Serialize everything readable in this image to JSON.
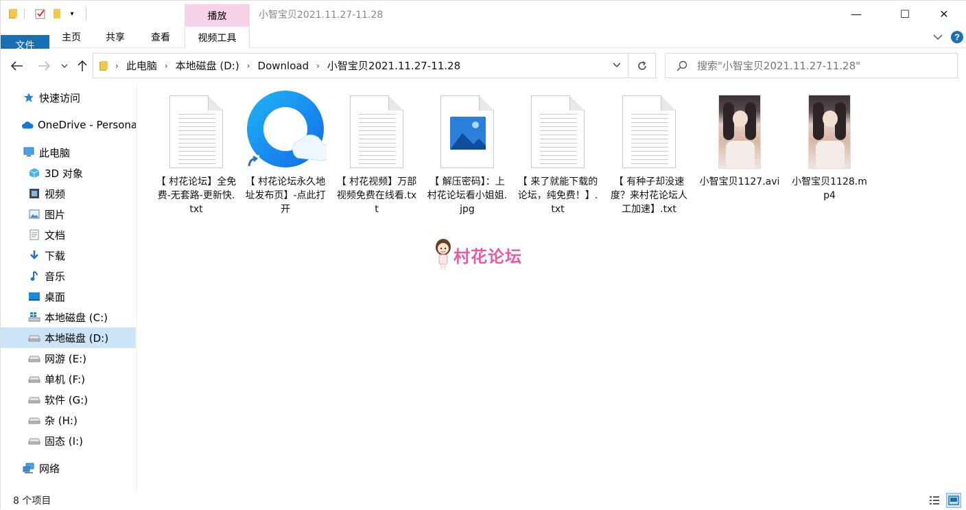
{
  "window": {
    "title": "小智宝贝2021.11.27-11.28",
    "context_tab": "播放",
    "minimize": "—",
    "maximize": "☐",
    "close": "✕"
  },
  "ribbon": {
    "tabs": [
      "文件",
      "主页",
      "共享",
      "查看",
      "视频工具"
    ],
    "accent": "#1a6fb3",
    "context_color": "#f6d3e6"
  },
  "nav": {
    "path": [
      "此电脑",
      "本地磁盘 (D:)",
      "Download",
      "小智宝贝2021.11.27-11.28"
    ],
    "search_placeholder": "搜索\"小智宝贝2021.11.27-11.28\""
  },
  "sidebar": {
    "items": [
      {
        "label": "快速访问",
        "icon": "star-icon"
      },
      {
        "label": "OneDrive - Persona",
        "icon": "cloud-icon"
      },
      {
        "label": "此电脑",
        "icon": "computer-icon"
      },
      {
        "label": "3D 对象",
        "icon": "cube-icon"
      },
      {
        "label": "视频",
        "icon": "film-icon"
      },
      {
        "label": "图片",
        "icon": "picture-icon"
      },
      {
        "label": "文档",
        "icon": "document-icon"
      },
      {
        "label": "下载",
        "icon": "download-icon"
      },
      {
        "label": "音乐",
        "icon": "music-icon"
      },
      {
        "label": "桌面",
        "icon": "desktop-icon"
      },
      {
        "label": "本地磁盘 (C:)",
        "icon": "windows-drive-icon"
      },
      {
        "label": "本地磁盘 (D:)",
        "icon": "drive-icon",
        "selected": true
      },
      {
        "label": "网游 (E:)",
        "icon": "drive-icon"
      },
      {
        "label": "单机 (F:)",
        "icon": "drive-icon"
      },
      {
        "label": "软件 (G:)",
        "icon": "drive-icon"
      },
      {
        "label": "杂 (H:)",
        "icon": "drive-icon"
      },
      {
        "label": "固态 (I:)",
        "icon": "drive-icon"
      },
      {
        "label": "网络",
        "icon": "network-icon"
      }
    ]
  },
  "files": [
    {
      "name": "【 村花论坛】全免费-无套路-更新快.txt",
      "type": "txt"
    },
    {
      "name": "【 村花论坛永久地址发布页】-点此打开",
      "type": "shortcut"
    },
    {
      "name": "【 村花视频】万部视频免费在线看.txt",
      "type": "txt"
    },
    {
      "name": "【 解压密码】：上村花论坛看小姐姐.jpg",
      "type": "jpg"
    },
    {
      "name": "【 来了就能下载的论坛，纯免费！】.txt",
      "type": "txt"
    },
    {
      "name": "【 有种子却没速度？来村花论坛人工加速】.txt",
      "type": "txt"
    },
    {
      "name": "小智宝贝1127.avi",
      "type": "video"
    },
    {
      "name": "小智宝贝1128.mp4",
      "type": "video"
    }
  ],
  "watermark": "村花论坛",
  "status": {
    "count": "8 个项目"
  }
}
